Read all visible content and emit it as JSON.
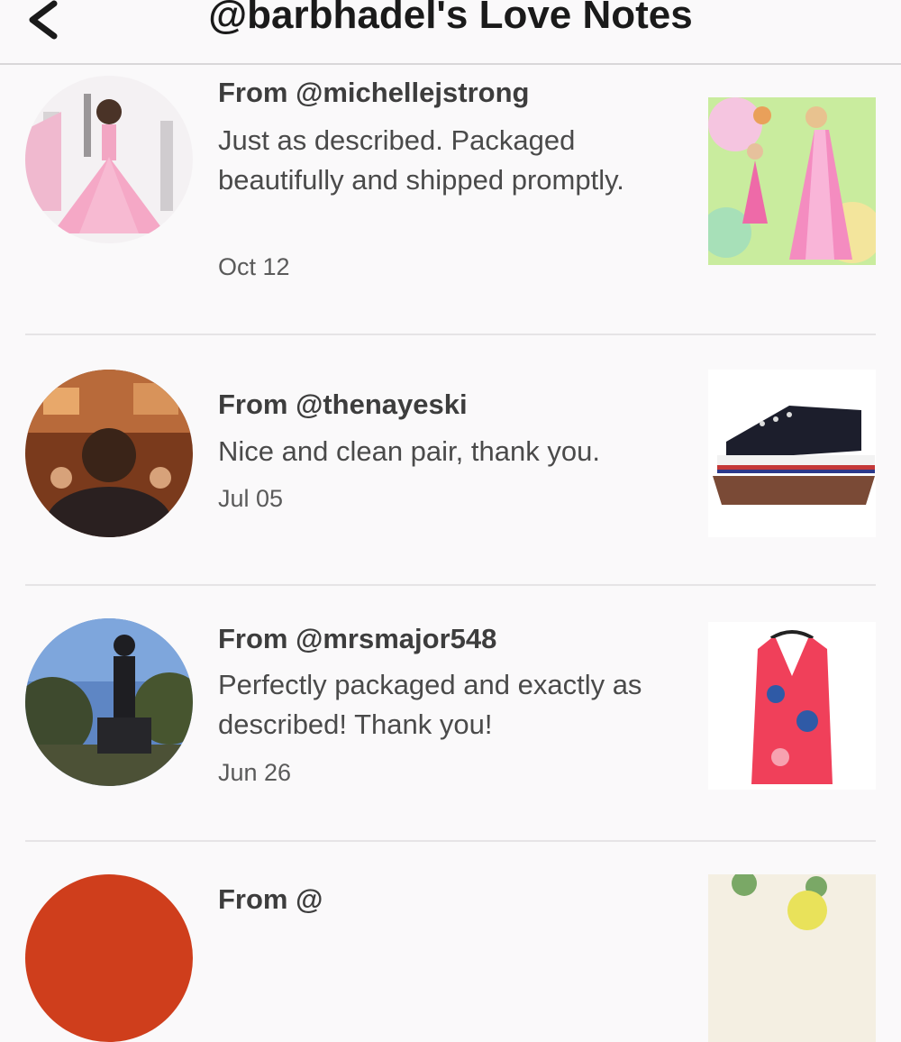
{
  "header": {
    "title": "@barbhadel's Love Notes",
    "back_icon": "chevron-left-icon"
  },
  "notes": [
    {
      "from": "From @michellejstrong",
      "message": "Just as described. Packaged beautifully and shipped promptly.",
      "date": "Oct 12"
    },
    {
      "from": "From @thenayeski",
      "message": "Nice and clean pair, thank you.",
      "date": "Jul 05"
    },
    {
      "from": "From @mrsmajor548",
      "message": "Perfectly packaged and exactly as described! Thank you!",
      "date": "Jun 26"
    },
    {
      "from": "From @"
    }
  ],
  "colors": {
    "background": "#faf9fa",
    "title": "#1a1a1a",
    "divider": "#e6e4e6"
  }
}
